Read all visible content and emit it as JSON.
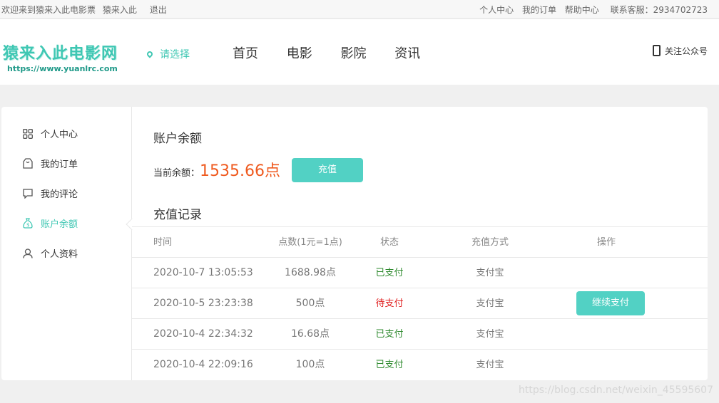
{
  "topbar": {
    "welcome": "欢迎来到猿来入此电影票",
    "username": "猿来入此",
    "logout": "退出",
    "links": [
      "个人中心",
      "我的订单",
      "帮助中心"
    ],
    "service": "联系客服：2934702723"
  },
  "header": {
    "logo_title": "猿来入此电影网",
    "logo_url": "https://www.yuanlrc.com",
    "city_label": "请选择",
    "nav": [
      "首页",
      "电影",
      "影院",
      "资讯"
    ],
    "follow": "关注公众号"
  },
  "sidebar": {
    "items": [
      {
        "label": "个人中心",
        "icon": "grid-icon"
      },
      {
        "label": "我的订单",
        "icon": "bag-icon"
      },
      {
        "label": "我的评论",
        "icon": "comment-icon"
      },
      {
        "label": "账户余额",
        "icon": "money-bag-icon"
      },
      {
        "label": "个人资料",
        "icon": "user-icon"
      }
    ],
    "active_index": 3
  },
  "balance": {
    "title": "账户余额",
    "label": "当前余额：",
    "value": "1535.66点",
    "recharge_button": "充值"
  },
  "records": {
    "title": "充值记录",
    "columns": [
      "时间",
      "点数(1元=1点)",
      "状态",
      "充值方式",
      "操作"
    ],
    "rows": [
      {
        "time": "2020-10-7 13:05:53",
        "points": "1688.98点",
        "status": "已支付",
        "method": "支付宝",
        "action": ""
      },
      {
        "time": "2020-10-5 23:23:38",
        "points": "500点",
        "status": "待支付",
        "method": "支付宝",
        "action": "继续支付"
      },
      {
        "time": "2020-10-4 22:34:32",
        "points": "16.68点",
        "status": "已支付",
        "method": "支付宝",
        "action": ""
      },
      {
        "time": "2020-10-4 22:09:16",
        "points": "100点",
        "status": "已支付",
        "method": "支付宝",
        "action": ""
      }
    ]
  },
  "watermark": "https://blog.csdn.net/weixin_45595607",
  "colors": {
    "accent": "#3fc7b3",
    "button": "#52d1c4",
    "balance": "#ef5a1f",
    "paid": "#2e8a2e",
    "pending": "#e02020"
  }
}
